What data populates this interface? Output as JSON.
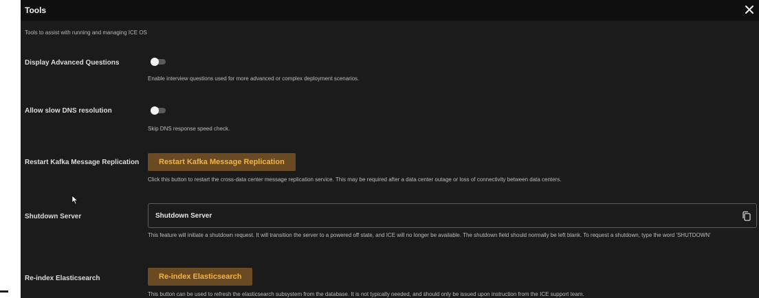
{
  "dialog": {
    "title": "Tools",
    "subtitle": "Tools to assist with running and managing ICE OS"
  },
  "settings": {
    "advanced": {
      "label": "Display Advanced Questions",
      "description": "Enable interview questions used for more advanced or complex deployment scenarios.",
      "enabled": false
    },
    "dns": {
      "label": "Allow slow DNS resolution",
      "description": "Skip DNS response speed check.",
      "enabled": false
    },
    "kafka": {
      "label": "Restart Kafka Message Replication",
      "button": "Restart Kafka Message Replication",
      "description": "Click this button to restart the cross-data center message replication service. This may be required after a data center outage or loss of connectivity between data centers."
    },
    "shutdown": {
      "label": "Shutdown Server",
      "placeholder": "Shutdown Server",
      "description": "This feature will initiate a shutdown request.  It will transition the server to a powered off state, and ICE will no longer be available. The shutdown field should normally be left blank.  To request a shutdown, type the word 'SHUTDOWN'"
    },
    "reindex": {
      "label": "Re-index Elasticsearch",
      "button": "Re-index Elasticsearch",
      "description": "This button can be used to refresh the elasticsearch subsystem from the database.  It is not typically needed, and should only be issued upon instruction from the ICE support team."
    }
  },
  "colors": {
    "background": "#1b1b1b",
    "titlebar": "#0f0f0f",
    "button_bg": "#6a4a22",
    "button_text": "#f2b347"
  },
  "icons": {
    "close": "close-icon",
    "copy": "copy-icon",
    "pointer": "mouse-pointer-icon"
  }
}
